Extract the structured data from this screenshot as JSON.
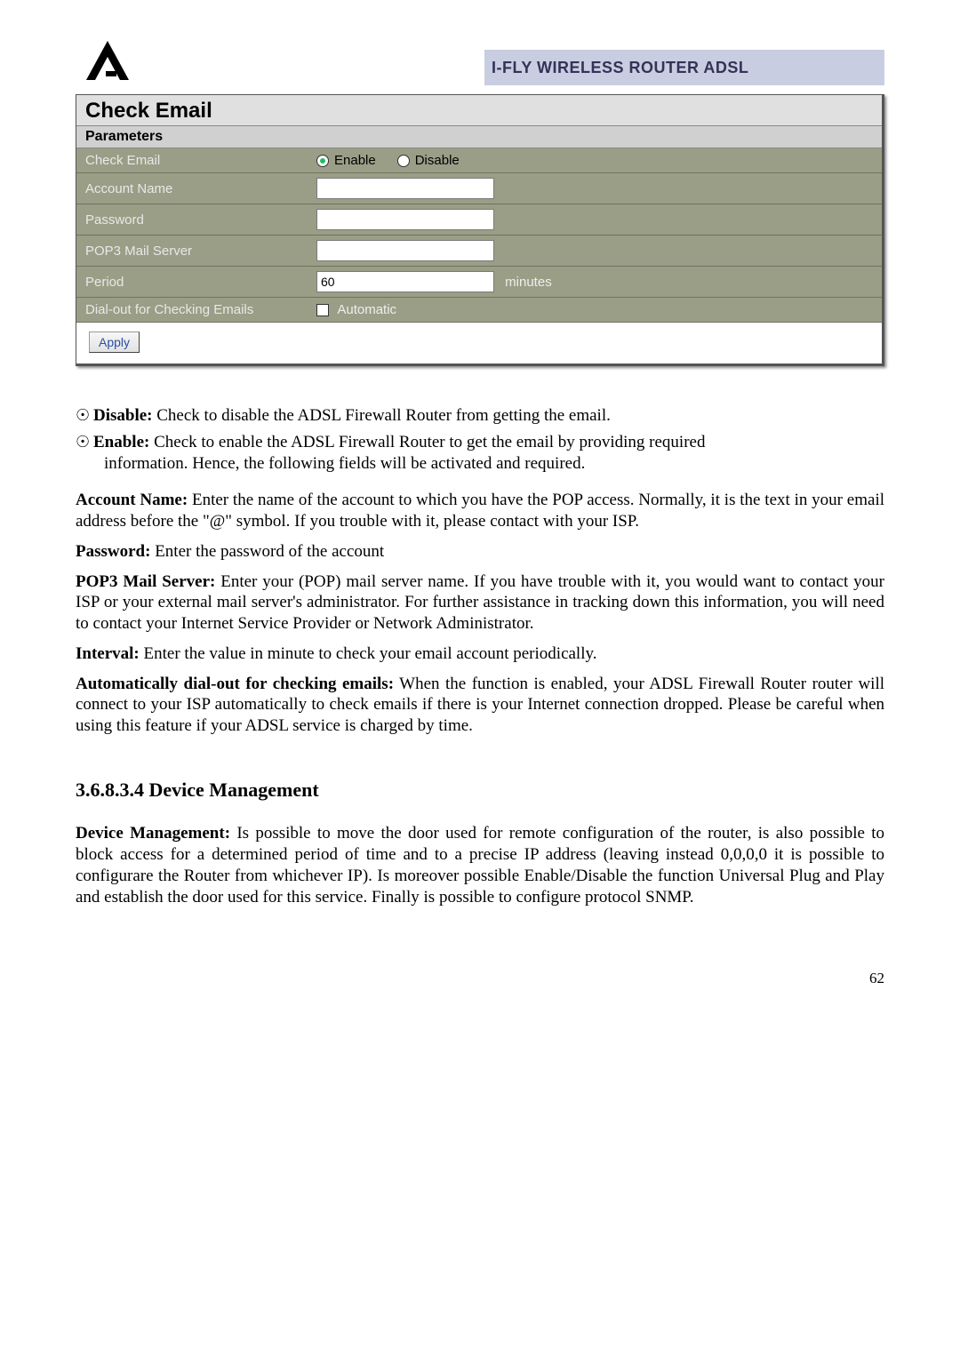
{
  "header": {
    "title": "I-FLY WIRELESS ROUTER ADSL"
  },
  "panel": {
    "title": "Check Email",
    "subtitle": "Parameters",
    "rows": {
      "check_email_label": "Check Email",
      "enable_label": "Enable",
      "disable_label": "Disable",
      "account_name_label": "Account Name",
      "account_name_value": "",
      "password_label": "Password",
      "password_value": "",
      "pop3_label": "POP3 Mail Server",
      "pop3_value": "",
      "period_label": "Period",
      "period_value": "60",
      "period_unit": "minutes",
      "dialout_label": "Dial-out for Checking Emails",
      "automatic_label": "Automatic"
    },
    "apply_label": "Apply"
  },
  "body": {
    "disable_text": " Check to disable the ADSL Firewall Router from getting the email.",
    "disable_bold": "Disable:",
    "enable_bold": "Enable:",
    "enable_text_1": " Check to enable the ADSL Firewall Router to get the email by providing required ",
    "enable_text_2": "information. Hence, the following fields will be activated and required.",
    "account_bold": "Account Name:",
    "account_text": " Enter the name of the account to which you have the POP access. Normally, it is the text in your email address before the \"@\" symbol. If you trouble with it, please contact with your ISP.",
    "password_bold": "Password:",
    "password_text": " Enter the password of the account",
    "pop3_bold": "POP3 Mail Server:",
    "pop3_text": " Enter your (POP) mail server name.  If you have trouble with it, you would want to contact your ISP or your external mail server's administrator. For further assistance in tracking down this information, you will need to contact your Internet Service Provider or Network Administrator.",
    "interval_bold": "Interval:",
    "interval_text": " Enter the value in minute to check your email account periodically.",
    "auto_bold": "Automatically dial-out for checking emails:",
    "auto_text": " When the function is enabled, your ADSL Firewall Router router will connect to your ISP automatically to check emails if there is your Internet connection dropped.  Please be careful when using this feature if your ADSL service is charged by time.",
    "section_heading": "3.6.8.3.4 Device Management",
    "dm_bold": "Device Management:",
    "dm_text": " Is  possible to move the door used for remote configuration of the router, is also possible to block access for a determined period of time and to a precise IP address (leaving instead 0,0,0,0 it is possible to configurare the Router from whichever IP).  Is  moreover possible Enable/Disable the function Universal Plug and Play and establish the door used for this service. Finally is possible to configure protocol SNMP."
  },
  "page_number": "62"
}
